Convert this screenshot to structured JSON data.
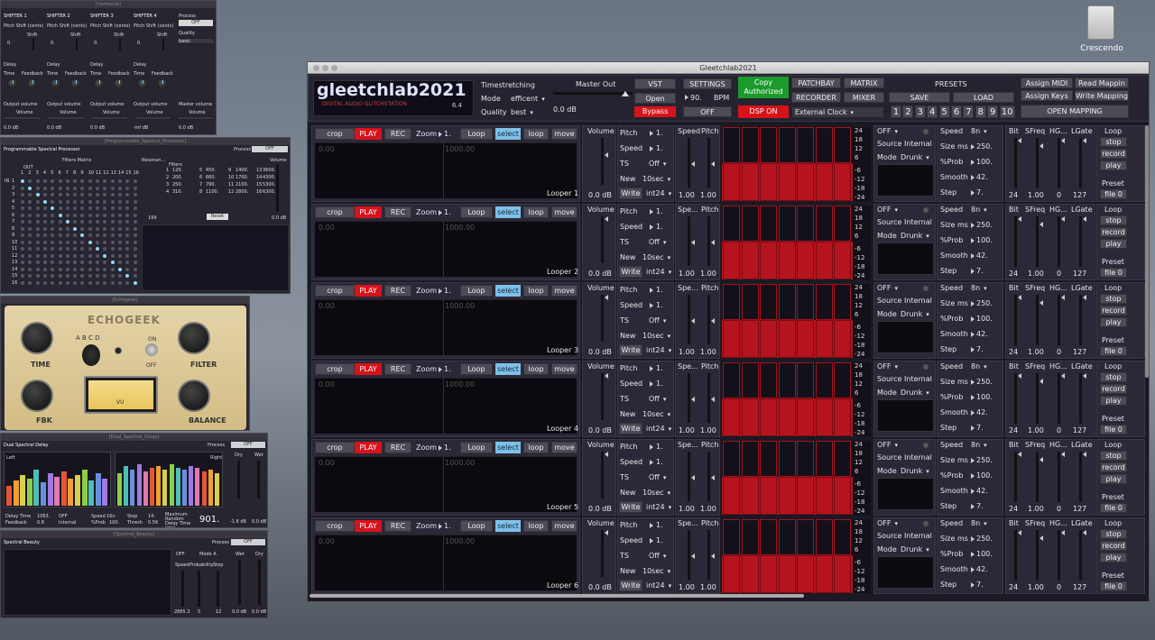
{
  "desktop": {
    "drive_label": "Crescendo"
  },
  "harmonia": {
    "title": "[harmonia]",
    "shifters": [
      {
        "name": "SHIFTER 1"
      },
      {
        "name": "SHIFTER 2"
      },
      {
        "name": "SHIFTER 3"
      },
      {
        "name": "SHIFTER 4"
      }
    ],
    "pitch_label": "Pitch Shift (cents)",
    "shift_label": "Shift",
    "shift_value": "0.",
    "delay_label": "Delay",
    "time_label": "Time",
    "feedback_label": "Feedback",
    "output_label": "Output volume",
    "volume_label": "Volume",
    "db_values": [
      "0.0 dB",
      "0.0 dB",
      "0.0 dB",
      "-inf dB",
      "0.0 dB"
    ],
    "process_label": "Process",
    "process_state": "OFF",
    "quality_label": "Quality",
    "quality_value": "basic",
    "master_label": "Master volume"
  },
  "psp": {
    "title": "[Programmable_Spectral_Processor]",
    "header": "Programmable Spectral Processor",
    "process_label": "Process",
    "process_state": "OFF",
    "matrix_label": "Filters Matrix",
    "out_label": "OUT",
    "in_label": "IN",
    "cols": [
      "1",
      "2",
      "3",
      "4",
      "5",
      "6",
      "7",
      "8",
      "9",
      "10",
      "11",
      "12",
      "13",
      "14",
      "15",
      "16"
    ],
    "resonance_label": "Resonan...",
    "filters_label": "Filters",
    "volume_label": "Volume",
    "filter_rows": [
      [
        "1",
        "120.",
        "5",
        "450.",
        "9",
        "1400.",
        "13",
        "3600."
      ],
      [
        "2",
        "200.",
        "6",
        "660.",
        "10",
        "1700.",
        "14",
        "4300."
      ],
      [
        "3",
        "250.",
        "7",
        "790.",
        "11",
        "2100.",
        "15",
        "5300."
      ],
      [
        "4",
        "310.",
        "8",
        "1100.",
        "12",
        "2800.",
        "16",
        "6300."
      ]
    ],
    "res_value": "199",
    "reset_label": "Reset",
    "db": "0.0 dB"
  },
  "echo": {
    "title": "[Echogeek]",
    "logo": "ECHOGEEK",
    "time": "TIME",
    "fbk": "FBK",
    "filter": "FILTER",
    "balance": "BALANCE",
    "abcd": "A B C D",
    "on": "ON",
    "off": "OFF",
    "vu": "VU"
  },
  "dsd": {
    "title": "[Dual_Spectral_Delay]",
    "header": "Dual Spectral Delay",
    "process_label": "Process",
    "process_state": "OFF",
    "left": "Left",
    "right": "Right",
    "dry": "Dry",
    "wet": "Wet",
    "delay_time": "Delay Time",
    "delay_val": "1063.",
    "feedback": "Feedback",
    "feedback_val": "0.8",
    "off": "OFF",
    "internal": "Internal",
    "speed": "Speed",
    "speed_val": "16n",
    "prob": "%Prob",
    "prob_val": "100.",
    "step": "Step",
    "step_val": "14.",
    "thresh": "Thresh",
    "thresh_val": "0.56",
    "max_label": "Maximum Random Delay Time (ms)",
    "max_val": "901.",
    "db1": "-1.6 dB",
    "db2": "0.0 dB"
  },
  "sb": {
    "title": "[Spectral_Beauty]",
    "header": "Spectral Beauty",
    "process_label": "Process",
    "process_state": "OFF",
    "off": "OFF",
    "mode": "Mode A",
    "speed": "Speed",
    "prob": "Probability",
    "step": "Step",
    "wet": "Wet",
    "dry": "Dry",
    "v1": "2865.3",
    "v2": "5",
    "v3": "12",
    "db1": "0.0 dB",
    "db2": "0.0 dB"
  },
  "main": {
    "title": "Gleetchlab2021",
    "logo": "gleetchlab2021",
    "logo_sub": "DIGITAL AUDIO GLITCHSTATION",
    "version": "6.4",
    "timestretching": "Timestretching",
    "mode_label": "Mode",
    "mode_value": "efficent",
    "quality_label": "Quality",
    "quality_value": "best",
    "master_out": "Master Out",
    "master_db": "0.0 dB",
    "vst": "VST",
    "open": "Open",
    "bypass": "Bypass",
    "settings": "SETTINGS",
    "bpm_value": "90.",
    "bpm_label": "BPM",
    "off": "OFF",
    "copy_authorized": "Copy Authorized",
    "dsp_on": "DSP ON",
    "patchbay": "PATCHBAY",
    "matrix": "MATRIX",
    "recorder": "RECORDER",
    "mixer": "MIXER",
    "clock": "External Clock",
    "presets": "PRESETS",
    "save": "SAVE",
    "load": "LOAD",
    "preset_numbers": [
      "1",
      "2",
      "3",
      "4",
      "5",
      "6",
      "7",
      "8",
      "9",
      "10"
    ],
    "assign_midi": "Assign MIDI",
    "read_mappin": "Read Mappin",
    "assign_keys": "Assign Keys",
    "write_mapping": "Write Mapping",
    "open_mapping": "OPEN MAPPING"
  },
  "loopers": [
    {
      "name": "Looper 1",
      "speed_label": "Speed"
    },
    {
      "name": "Looper 2",
      "speed_label": "Spe..."
    },
    {
      "name": "Looper 3",
      "speed_label": "Spe..."
    },
    {
      "name": "Looper 4",
      "speed_label": "Spe..."
    },
    {
      "name": "Looper 5",
      "speed_label": "Spe..."
    },
    {
      "name": "Looper 6",
      "speed_label": "Spe..."
    }
  ],
  "looper_common": {
    "crop": "crop",
    "play": "PLAY",
    "rec": "REC",
    "zoom": "Zoom",
    "zoom_val": "1.",
    "loop_cap": "Loop",
    "select": "select",
    "loop": "loop",
    "move": "move",
    "t0": "0.00",
    "t1": "1000.00",
    "volume": "Volume",
    "vol_db": "0.0 dB",
    "pitch": "Pitch",
    "pitch_val": "1.",
    "speed": "Speed",
    "speed_val": "1.",
    "ts": "TS",
    "ts_val": "Off",
    "new": "New",
    "new_val": "10sec",
    "write": "Write",
    "bits": "int24",
    "pitch2": "Pitch",
    "v100a": "1.00",
    "v100b": "1.00",
    "db_scale": [
      "24",
      "18",
      "12",
      "6",
      "-6",
      "-12",
      "-18",
      "-24"
    ],
    "off": "OFF",
    "source": "Source Internal",
    "mode": "Mode",
    "drunk": "Drunk",
    "gspeed": "Speed",
    "gspeed_val": "8n",
    "size": "Size ms",
    "size_val": "250.",
    "prob": "%Prob",
    "prob_val": "100.",
    "smooth": "Smooth",
    "smooth_val": "42.",
    "step": "Step",
    "step_val": "7.",
    "bit": "Bit",
    "sfreq": "SFreq",
    "hg": "HG...",
    "lgate": "LGate",
    "bit_val": "24",
    "sfreq_val": "1.00",
    "hg_val": "0",
    "lgate_val": "127",
    "loop_btn": "Loop",
    "stop": "stop",
    "record": "record",
    "play2": "play",
    "preset": "Preset",
    "file": "file 0"
  }
}
